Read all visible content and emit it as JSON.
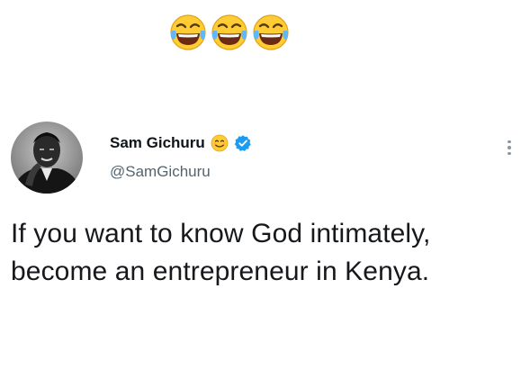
{
  "caption": {
    "emojis": [
      "face-with-tears-of-joy-icon",
      "face-with-tears-of-joy-icon",
      "face-with-tears-of-joy-icon"
    ]
  },
  "tweet": {
    "author": {
      "name": "Sam Gichuru",
      "handle": "@SamGichuru",
      "name_emoji": "smiling-face-icon",
      "verified": true
    },
    "text": "If you want to know God intimately, become an entrepreneur in Kenya."
  },
  "colors": {
    "verified": "#1d9bf0",
    "handle": "#536471",
    "text": "#16181c",
    "emoji_face": "#ffcc33",
    "tears": "#5fb7ff"
  }
}
